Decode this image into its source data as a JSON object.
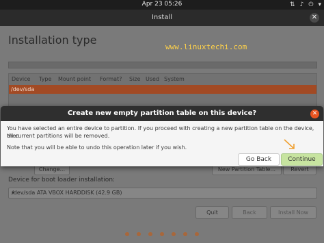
{
  "topbar": {
    "clock": "Apr 23  05:26",
    "tray_icons": [
      "network-icon",
      "volume-icon",
      "power-icon",
      "chevron-down-icon"
    ]
  },
  "window": {
    "title": "Install",
    "heading": "Installation type",
    "watermark": "www.linuxtechi.com"
  },
  "table": {
    "columns": [
      "Device",
      "Type",
      "Mount point",
      "Format?",
      "Size",
      "Used",
      "System"
    ],
    "selected_row": "/dev/sda"
  },
  "partition_controls": {
    "change_label": "Change...",
    "new_table_label": "New Partition Table...",
    "revert_label": "Revert"
  },
  "bootloader": {
    "label": "Device for boot loader installation:",
    "selected": "/dev/sda ATA VBOX HARDDISK (42.9 GB)"
  },
  "footer": {
    "quit_label": "Quit",
    "back_label": "Back",
    "install_label": "Install Now"
  },
  "progress": {
    "total_dots": 7,
    "active_dots": 7
  },
  "dialog": {
    "title": "Create new empty partition table on this device?",
    "message_line1": "You have selected an entire device to partition. If you proceed with creating a new partition table on the device, then",
    "message_line2": "all current partitions will be removed.",
    "note": "Note that you will be able to undo this operation later if you wish.",
    "go_back_label": "Go Back",
    "continue_label": "Continue"
  },
  "colors": {
    "accent": "#e95420",
    "continue_bg": "#c7e4a0",
    "annotation_arrow": "#f0a030"
  }
}
